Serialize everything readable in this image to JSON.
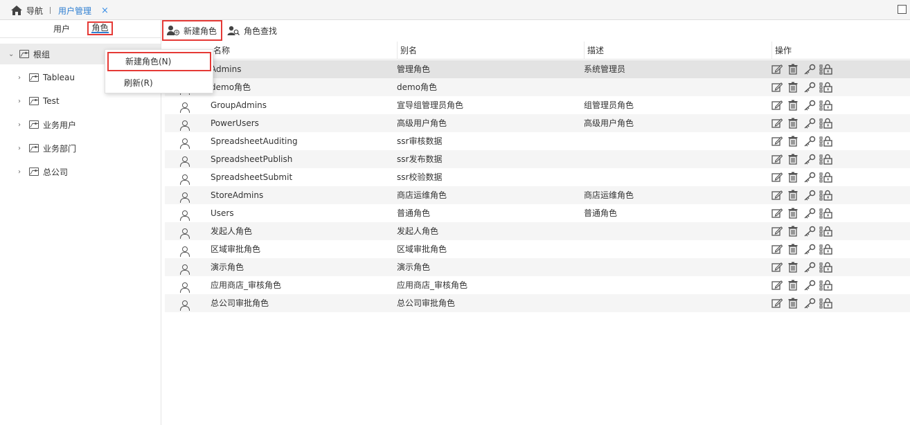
{
  "topbar": {
    "home_label": "导航",
    "active_tab_label": "用户管理",
    "close_glyph": "×"
  },
  "left": {
    "tabs": [
      {
        "label": "用户"
      },
      {
        "label": "角色"
      }
    ],
    "tree": [
      {
        "label": "根组",
        "expanded": true
      },
      {
        "label": "Tableau"
      },
      {
        "label": "Test"
      },
      {
        "label": "业务用户"
      },
      {
        "label": "业务部门"
      },
      {
        "label": "总公司"
      }
    ]
  },
  "context_menu": {
    "items": [
      {
        "label": "新建角色(N)"
      },
      {
        "label": "刷新(R)"
      }
    ]
  },
  "toolbar": {
    "new_role_label": "新建角色",
    "find_role_label": "角色查找"
  },
  "grid": {
    "columns": [
      {
        "label": "名称"
      },
      {
        "label": "别名"
      },
      {
        "label": "描述"
      },
      {
        "label": "操作"
      }
    ],
    "rows": [
      {
        "name": "Admins",
        "alias": "管理角色",
        "desc": "系统管理员"
      },
      {
        "name": "demo角色",
        "alias": "demo角色",
        "desc": ""
      },
      {
        "name": "GroupAdmins",
        "alias": "宣导组管理员角色",
        "desc": "组管理员角色"
      },
      {
        "name": "PowerUsers",
        "alias": "高级用户角色",
        "desc": "高级用户角色"
      },
      {
        "name": "SpreadsheetAuditing",
        "alias": "ssr审核数据",
        "desc": ""
      },
      {
        "name": "SpreadsheetPublish",
        "alias": "ssr发布数据",
        "desc": ""
      },
      {
        "name": "SpreadsheetSubmit",
        "alias": "ssr校验数据",
        "desc": ""
      },
      {
        "name": "StoreAdmins",
        "alias": "商店运维角色",
        "desc": "商店运维角色"
      },
      {
        "name": "Users",
        "alias": "普通角色",
        "desc": "普通角色"
      },
      {
        "name": "发起人角色",
        "alias": "发起人角色",
        "desc": ""
      },
      {
        "name": "区域审批角色",
        "alias": "区域审批角色",
        "desc": ""
      },
      {
        "name": "演示角色",
        "alias": "演示角色",
        "desc": ""
      },
      {
        "name": "应用商店_审核角色",
        "alias": "应用商店_审核角色",
        "desc": ""
      },
      {
        "name": "总公司审批角色",
        "alias": "总公司审批角色",
        "desc": ""
      }
    ]
  },
  "colors": {
    "accent": "#2f7fd1",
    "highlight_border": "#e53935",
    "selected_row": "#e3e3e3"
  }
}
